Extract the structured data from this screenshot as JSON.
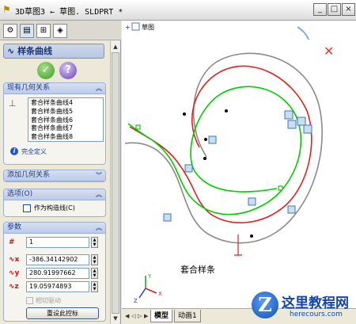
{
  "window": {
    "title": "3D草图3 ← 草图. SLDPRT *",
    "minimize_label": "_",
    "maximize_label": "□",
    "close_label": "×",
    "title_icon": "sketch-doc-icon"
  },
  "panel": {
    "tabs": [
      "feature-manager-icon",
      "property-manager-icon",
      "configuration-manager-icon",
      "dimxpert-icon"
    ],
    "header": "样条曲线",
    "ok_label": "✓",
    "help_label": "?",
    "existing_relations": {
      "title": "现有几何关系",
      "items": [
        "套合样条曲线4",
        "套合样条曲线5",
        "套合样条曲线6",
        "套合样条曲线7",
        "套合样条曲线8"
      ],
      "status": "完全定义"
    },
    "add_relations": {
      "title": "添加几何关系"
    },
    "options": {
      "title": "选项(O)",
      "construction_label": "作为构造线(C)"
    },
    "parameters": {
      "title": "参数",
      "rows": [
        {
          "icon": "spline-point-icon",
          "value": "1"
        },
        {
          "icon": "x-coordinate-icon",
          "value": "-386.34142902"
        },
        {
          "icon": "y-coordinate-icon",
          "value": "280.91997662"
        },
        {
          "icon": "z-coordinate-icon",
          "value": "19.05974893"
        }
      ],
      "tangent_driving_label": "相切驱动",
      "reset_label": "重设此控标"
    }
  },
  "canvas": {
    "tree_item": "草图",
    "annotation": "套合样条",
    "axes": {
      "x": "X",
      "y": "Y",
      "z": "Z"
    },
    "colors": {
      "green": "#00cc00",
      "red": "#e02020",
      "gray": "#8a8a8a"
    }
  },
  "bottom_tabs": {
    "model": "模型",
    "animation": "动画1"
  },
  "watermark": {
    "title": "这里教程网",
    "url": "herecours.com",
    "logo_letter": "Z"
  }
}
